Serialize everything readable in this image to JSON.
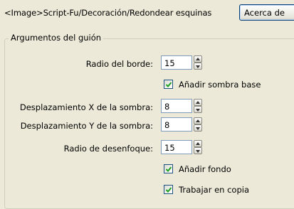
{
  "header": {
    "path": "<Image>Script-Fu/Decoración/Redondear esquinas",
    "about_label": "Acerca de"
  },
  "group": {
    "title": "Argumentos del guión"
  },
  "fields": [
    {
      "label": "Radio del borde:",
      "value": "15"
    },
    {
      "label": "Desplazamiento X de la sombra:",
      "value": "8"
    },
    {
      "label": "Desplazamiento Y de la sombra:",
      "value": "8"
    },
    {
      "label": "Radio de desenfoque:",
      "value": "15"
    }
  ],
  "checkboxes": [
    {
      "label": "Añadir sombra base",
      "checked": true
    },
    {
      "label": "Añadir fondo",
      "checked": true
    },
    {
      "label": "Trabajar en copia",
      "checked": true
    }
  ],
  "colors": {
    "window_bg": "#ece9d8",
    "check_green": "#21a121",
    "checkbox_border": "#1c5180",
    "field_border": "#7f9db9"
  }
}
